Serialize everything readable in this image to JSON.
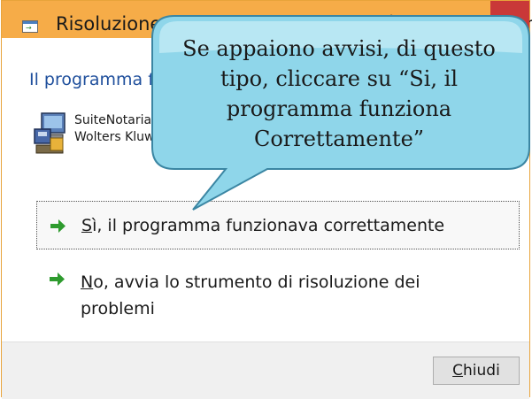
{
  "window": {
    "title": "Risoluzione problemi di compatibilità dei programmi",
    "heading": "Il programma funziona correttamente?"
  },
  "program": {
    "line1": "SuiteNotariato",
    "line2": "Wolters Kluwer Italia",
    "icon": "installer-icon"
  },
  "options": [
    {
      "hotkey": "S",
      "rest": "ì, il programma funzionava correttamente",
      "icon": "green-arrow-icon"
    },
    {
      "hotkey": "N",
      "rest": "o, avvia lo strumento di risoluzione dei problemi",
      "icon": "green-arrow-icon"
    }
  ],
  "footer": {
    "close_hotkey": "C",
    "close_rest": "hiudi"
  },
  "callout": {
    "text": "Se appaiono avvisi, di questo tipo, cliccare su “Si, il programma funziona Correttamente”"
  },
  "colors": {
    "titlebar": "#f6ac48",
    "close": "#c93838",
    "heading": "#1f4f9c",
    "arrow": "#2e9b2e",
    "callout_fill": "#8fd6ea",
    "callout_stroke": "#3b86a3"
  }
}
